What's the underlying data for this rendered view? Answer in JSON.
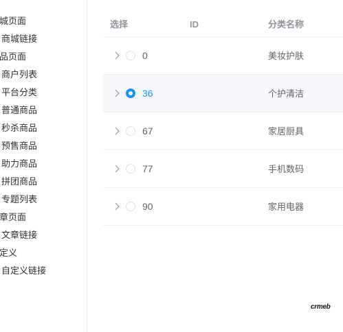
{
  "sidebar": {
    "items": [
      {
        "label": "城页面"
      },
      {
        "label": "商城链接"
      },
      {
        "label": "品页面"
      },
      {
        "label": "商户列表"
      },
      {
        "label": "平台分类"
      },
      {
        "label": "普通商品"
      },
      {
        "label": "秒杀商品"
      },
      {
        "label": "预售商品"
      },
      {
        "label": "助力商品"
      },
      {
        "label": "拼团商品"
      },
      {
        "label": "专题列表"
      },
      {
        "label": "章页面"
      },
      {
        "label": "文章链接"
      },
      {
        "label": "定义"
      },
      {
        "label": "自定义链接"
      }
    ]
  },
  "table": {
    "headers": {
      "select": "选择",
      "id": "ID",
      "name": "分类名称"
    },
    "rows": [
      {
        "id": "0",
        "name": "美妆护肤",
        "selected": false
      },
      {
        "id": "36",
        "name": "个护清洁",
        "selected": true
      },
      {
        "id": "67",
        "name": "家居厨具",
        "selected": false
      },
      {
        "id": "77",
        "name": "手机数码",
        "selected": false
      },
      {
        "id": "90",
        "name": "家用电器",
        "selected": false
      }
    ]
  },
  "brand": {
    "logo_text": "crmeb"
  },
  "colors": {
    "accent": "#1890ff",
    "border": "#ebeef5",
    "header_text": "#909399",
    "selected_row": "#f5f7fa"
  },
  "icons": {
    "expand": "chevron-right-icon",
    "radio": "radio-icon"
  }
}
